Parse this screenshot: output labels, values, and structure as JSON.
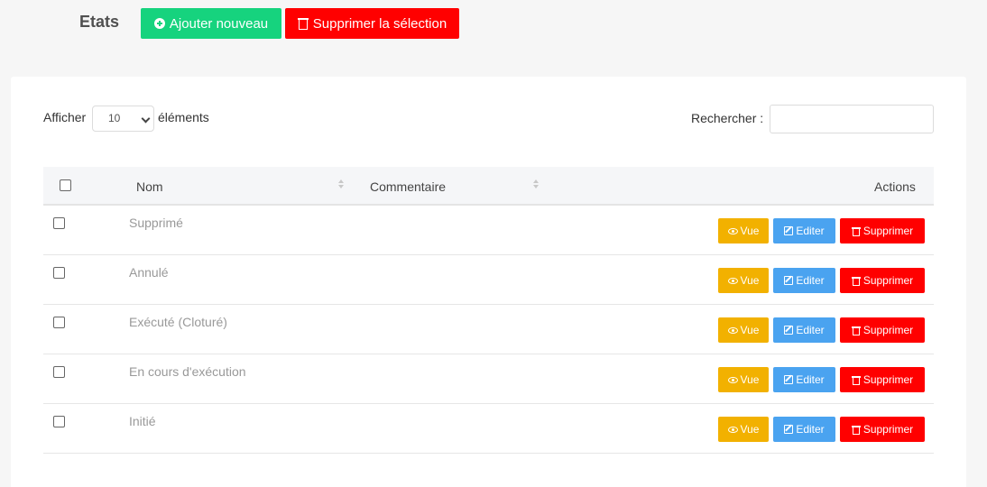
{
  "header": {
    "title": "Etats",
    "add_label": "Ajouter nouveau",
    "delete_selection_label": "Supprimer la sélection"
  },
  "controls": {
    "show_label": "Afficher",
    "page_length": "10",
    "elements_label": "éléments",
    "search_label": "Rechercher :",
    "search_value": ""
  },
  "table": {
    "columns": [
      "Nom",
      "Commentaire",
      "Actions"
    ],
    "rows": [
      {
        "name": "Supprimé",
        "comment": ""
      },
      {
        "name": "Annulé",
        "comment": ""
      },
      {
        "name": "Exécuté (Cloturé)",
        "comment": ""
      },
      {
        "name": "En cours d'exécution",
        "comment": ""
      },
      {
        "name": "Initié",
        "comment": ""
      }
    ],
    "actions": {
      "view": "Vue",
      "edit": "Editer",
      "delete": "Supprimer"
    }
  },
  "colors": {
    "add": "#16d37e",
    "delete": "#ff0000",
    "view": "#f2b100",
    "edit": "#4aa3f0"
  }
}
